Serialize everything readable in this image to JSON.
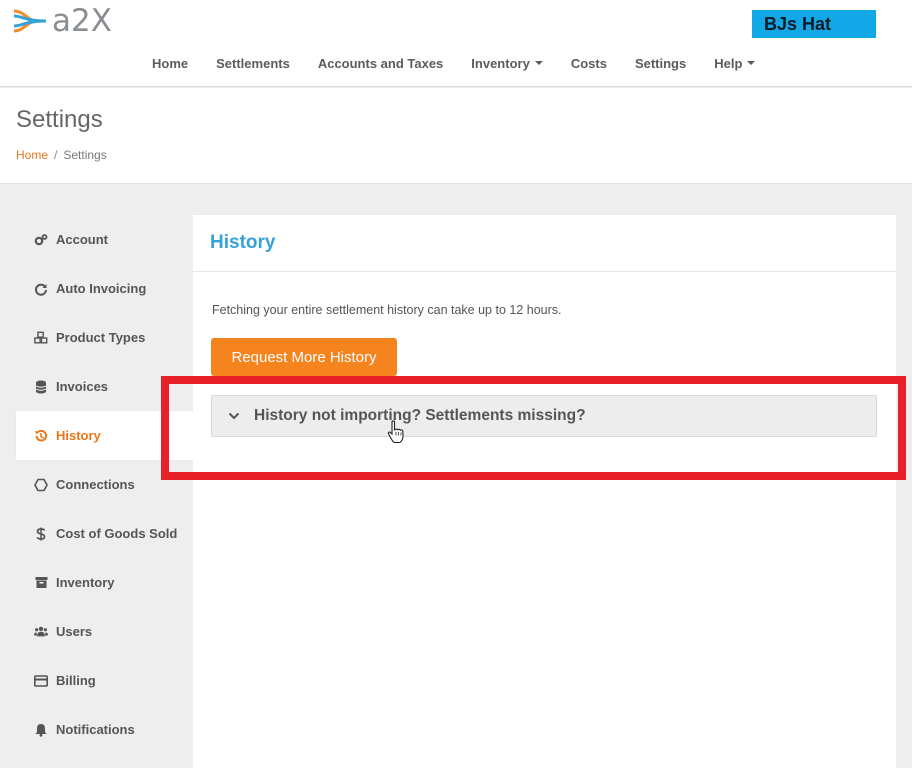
{
  "app": {
    "logo_text": "a2X",
    "org_name": "BJs Hat"
  },
  "nav": {
    "items": [
      {
        "label": "Home",
        "dropdown": false
      },
      {
        "label": "Settlements",
        "dropdown": false
      },
      {
        "label": "Accounts and Taxes",
        "dropdown": false
      },
      {
        "label": "Inventory",
        "dropdown": true
      },
      {
        "label": "Costs",
        "dropdown": false
      },
      {
        "label": "Settings",
        "dropdown": false
      },
      {
        "label": "Help",
        "dropdown": true
      }
    ]
  },
  "page": {
    "title": "Settings",
    "breadcrumb": {
      "home": "Home",
      "separator": "/",
      "current": "Settings"
    }
  },
  "sidebar": {
    "items": [
      {
        "label": "Account",
        "icon": "gears-icon"
      },
      {
        "label": "Auto Invoicing",
        "icon": "refresh-icon"
      },
      {
        "label": "Product Types",
        "icon": "cubes-icon"
      },
      {
        "label": "Invoices",
        "icon": "database-icon"
      },
      {
        "label": "History",
        "icon": "history-icon",
        "active": true
      },
      {
        "label": "Connections",
        "icon": "hexagon-icon"
      },
      {
        "label": "Cost of Goods Sold",
        "icon": "dollar-icon"
      },
      {
        "label": "Inventory",
        "icon": "archive-icon"
      },
      {
        "label": "Users",
        "icon": "users-icon"
      },
      {
        "label": "Billing",
        "icon": "credit-card-icon"
      },
      {
        "label": "Notifications",
        "icon": "bell-icon"
      }
    ]
  },
  "history": {
    "title": "History",
    "description": "Fetching your entire settlement history can take up to 12 hours.",
    "request_button": "Request More History",
    "accordion_title": "History not importing? Settlements missing?"
  },
  "colors": {
    "accent_orange": "#f5841f",
    "title_blue": "#35a3d8",
    "badge_blue": "#12a7e6",
    "highlight_red": "#e8202a"
  }
}
